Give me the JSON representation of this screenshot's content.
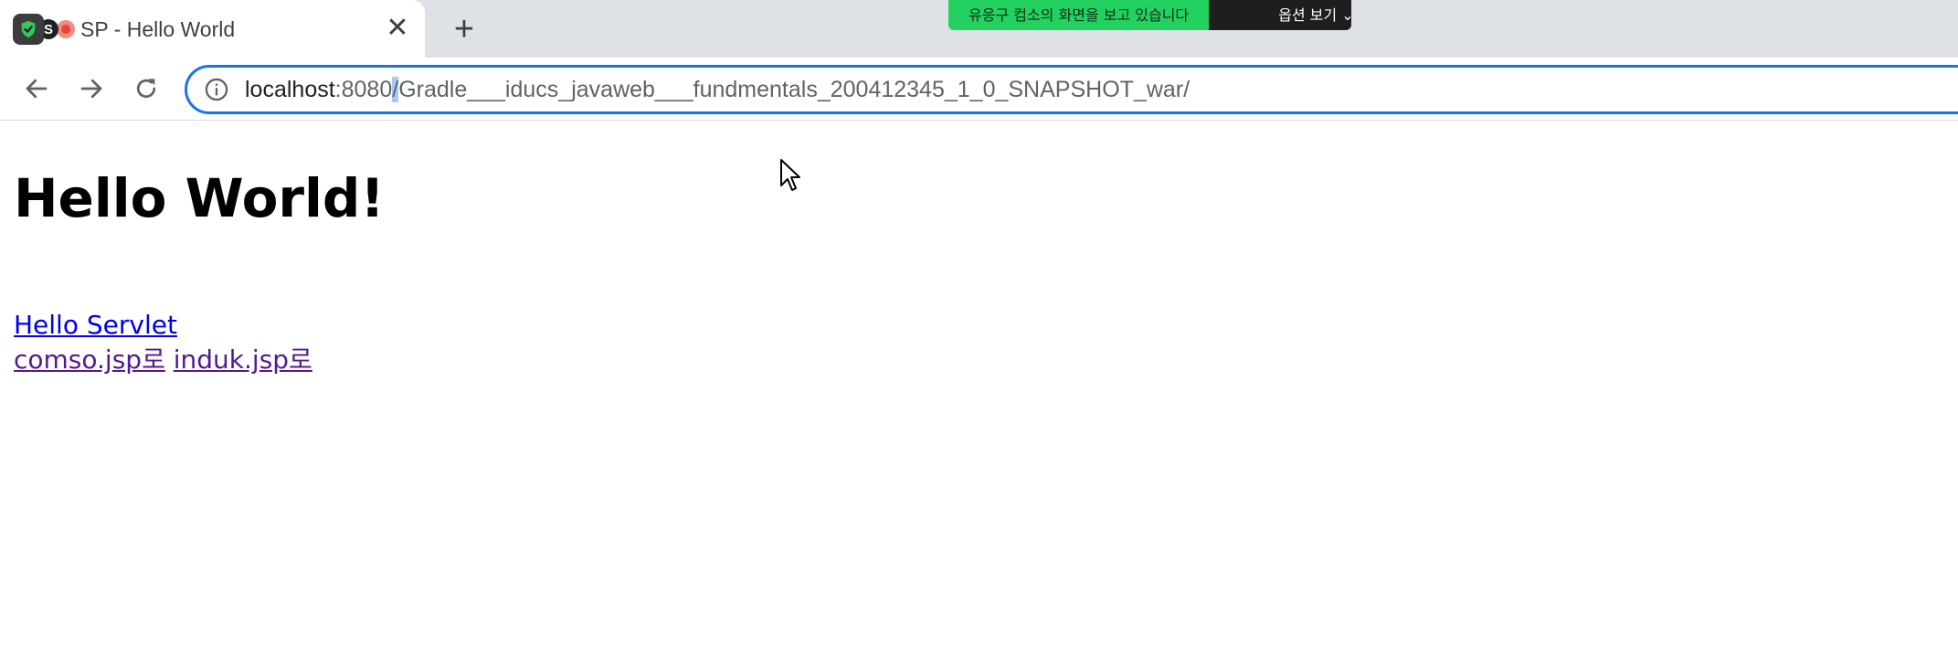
{
  "tab": {
    "title": "JSP - Hello World",
    "visible_title": "SP - Hello World",
    "favicon_letter": "S",
    "close_label": "✕"
  },
  "new_tab_label": "+",
  "screen_share": {
    "status_text": "유응구 컴소의 화면을 보고 있습니다",
    "options_label": "옵션 보기 ⌄"
  },
  "address_bar": {
    "host": "localhost",
    "port_text": ":8080",
    "selected_text": "/",
    "path_rest": "Gradle___iducs_javaweb___fundmentals_200412345_1_0_SNAPSHOT_war/"
  },
  "page": {
    "heading": "Hello World!",
    "links": [
      {
        "label": "Hello Servlet",
        "visited": false
      },
      {
        "label": "comso.jsp로",
        "visited": true
      },
      {
        "label": "induk.jsp로",
        "visited": true
      }
    ]
  },
  "colors": {
    "tabstrip_bg": "#dee1e6",
    "omnibox_focus": "#1a73e8",
    "link_unvisited": "#0000ee",
    "link_visited": "#551a8b",
    "share_green": "#23d160"
  }
}
